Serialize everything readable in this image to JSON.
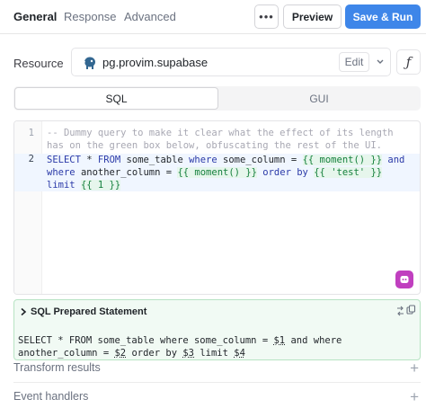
{
  "tabs": [
    {
      "label": "General",
      "active": true
    },
    {
      "label": "Response",
      "active": false
    },
    {
      "label": "Advanced",
      "active": false
    }
  ],
  "header": {
    "more_label": "•••",
    "preview_label": "Preview",
    "run_label": "Save & Run",
    "accent": "#3e86e9"
  },
  "resource": {
    "label": "Resource",
    "name": "pg.provim.supabase",
    "edit_label": "Edit",
    "icon": "postgres-elephant-icon",
    "fx_label": "ƒ"
  },
  "mode_toggle": {
    "options": [
      "SQL",
      "GUI"
    ],
    "selected": "SQL"
  },
  "editor": {
    "line_numbers": [
      "1",
      "2"
    ],
    "comment_line_1": "-- Dummy query to make it clear what the effect of its length",
    "comment_line_2": "has on the green box below, obfuscating the rest of the UI.",
    "tokens": {
      "select": "SELECT",
      "star": "*",
      "from": "FROM",
      "table": "some_table",
      "where": "where",
      "col1": "some_column",
      "eq": "=",
      "tpl_moment": "{{ moment() }}",
      "and": "and",
      "col2": "another_column",
      "order": "order",
      "by": "by",
      "tpl_test_open": "{{",
      "str_test": "'test'",
      "tpl_close": "}}",
      "limit": "limit",
      "tpl_one": "{{ 1 }}"
    },
    "badge_icon": "retool-ai-icon"
  },
  "prepared": {
    "title": "SQL Prepared Statement",
    "line_1_pre": "SELECT * FROM some_table where some_column = ",
    "p1": "$1",
    "line_1_post": " and where",
    "line_2_pre": "another_column = ",
    "p2": "$2",
    "line_2_mid": " order by ",
    "p3": "$3",
    "line_2_mid2": " limit ",
    "p4": "$4"
  },
  "sections": [
    {
      "label": "Transform results"
    },
    {
      "label": "Event handlers"
    }
  ]
}
